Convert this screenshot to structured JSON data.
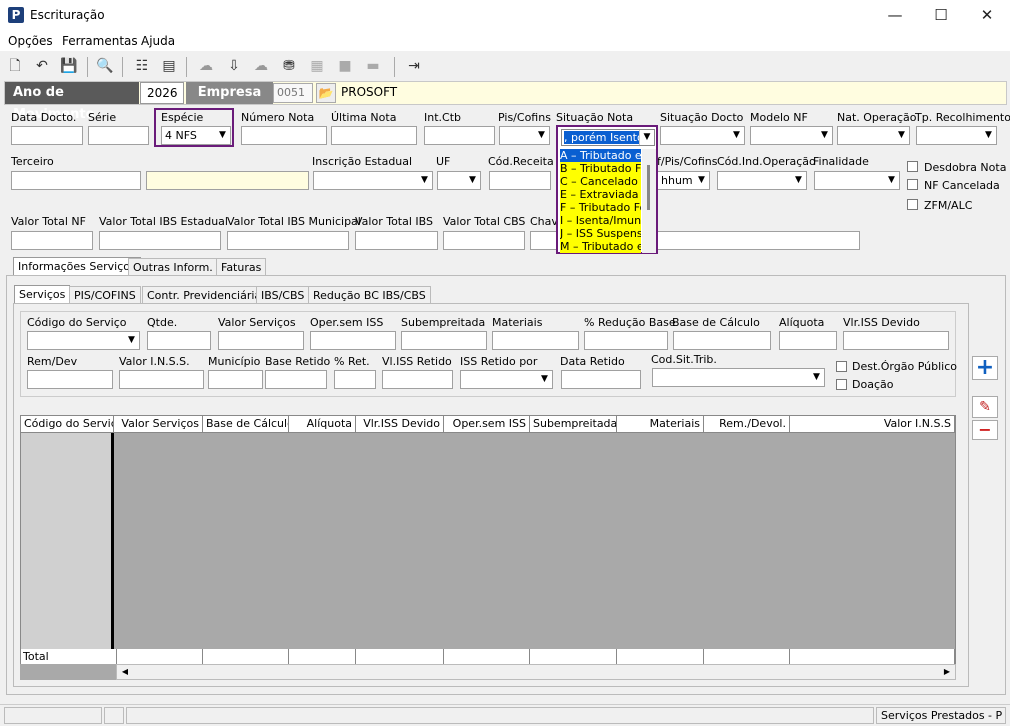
{
  "window": {
    "title": "Escrituração",
    "app_icon_letter": "P",
    "minimize": "—",
    "maximize": "☐",
    "close": "✕"
  },
  "menu": [
    "Opções",
    "Ferramentas",
    "Ajuda"
  ],
  "toolbar_icons": [
    "new-doc-icon",
    "undo-icon",
    "save-icon",
    "print-preview-icon",
    "tree-icon",
    "print-list-icon",
    "cloud-icon",
    "import-icon",
    "cloud2-icon",
    "cib-icon",
    "grid-icon",
    "box-icon",
    "minus-icon",
    "exit-door-icon"
  ],
  "year_bar": {
    "ano_label": "Ano de Movimento",
    "ano_value": "2026",
    "empresa_label": "Empresa",
    "empresa_code": "0051",
    "empresa_name": "PROSOFT"
  },
  "fields_row1": {
    "data_docto": "Data Docto.",
    "serie": "Série",
    "especie": "Espécie",
    "especie_value": "4 NFS",
    "numero_nota": "Número Nota",
    "ultima_nota": "Última Nota",
    "int_ctb": "Int.Ctb",
    "pis_cofins": "Pis/Cofins",
    "situacao_nota": "Situação Nota",
    "situacao_nota_value": ", porém Isento",
    "situacao_docto": "Situação Docto",
    "modelo_nf": "Modelo NF",
    "nat_operacao": "Nat. Operação",
    "tp_recolhimento": "Tp. Recolhimento"
  },
  "fields_row2": {
    "terceiro": "Terceiro",
    "inscricao_estadual": "Inscrição Estadual",
    "uf": "UF",
    "cod_receita": "Cód.Receita",
    "pis_cofins2": "f/Pis/Cofins",
    "pis_cofins2_value": "hhum",
    "cod_ind_operacao": "Cód.Ind.Operação",
    "finalidade": "Finalidade",
    "desdobra": "Desdobra Nota",
    "nf_cancelada": "NF Cancelada",
    "zfm": "ZFM/ALC"
  },
  "fields_row3": {
    "valor_total_nf": "Valor Total NF",
    "valor_ibs_estadual": "Valor Total IBS Estadual",
    "valor_ibs_municipal": "Valor Total IBS Municipal",
    "valor_ibs": "Valor Total IBS",
    "valor_cbs": "Valor Total CBS",
    "chave": "Chave"
  },
  "dropdown_items": [
    "A – Tributado em",
    "B – Tributado Fo",
    "C – Cancelado",
    "E – Extraviada",
    "F – Tributado Fo",
    "I – Isenta/Imune",
    "J – ISS Suspenso",
    "M – Tributado em"
  ],
  "tabs_main": [
    "Informações Serviços",
    "Outras Inform.",
    "Faturas"
  ],
  "tabs_sub": [
    "Serviços",
    "PIS/COFINS",
    "Contr. Previdenciária",
    "IBS/CBS",
    "Redução BC IBS/CBS"
  ],
  "serv_row1": [
    "Código do Serviço",
    "Qtde.",
    "Valor Serviços",
    "Oper.sem ISS",
    "Subempreitada",
    "Materiais",
    "% Redução Base",
    "Base de Cálculo",
    "Alíquota",
    "Vlr.ISS Devido"
  ],
  "serv_row2": {
    "rem_dev": "Rem/Dev",
    "valor_inss": "Valor I.N.S.S.",
    "municipio": "Município",
    "base_retido": "Base Retido",
    "pct_ret": "% Ret.",
    "vl_iss_retido": "Vl.ISS Retido",
    "iss_retido_por": "ISS Retido por",
    "data_retido": "Data Retido",
    "cod_sit_trib": "Cod.Sit.Trib.",
    "dest_orgao": "Dest.Órgão Público",
    "doacao": "Doação"
  },
  "grid_headers": [
    "Código do Serviço",
    "Valor Serviços",
    "Base de Cálculo",
    "Alíquota",
    "Vlr.ISS Devido",
    "Oper.sem ISS",
    "Subempreitada",
    "Materiais",
    "Rem./Devol.",
    "Valor I.N.S.S"
  ],
  "grid_total_label": "Total",
  "status_bar": {
    "right_text": "Serviços Prestados - P"
  },
  "colors": {
    "accent_purple": "#6a1b7a",
    "dropdown_yellow": "#ffff00",
    "dropdown_sel": "#0a5fd1"
  }
}
